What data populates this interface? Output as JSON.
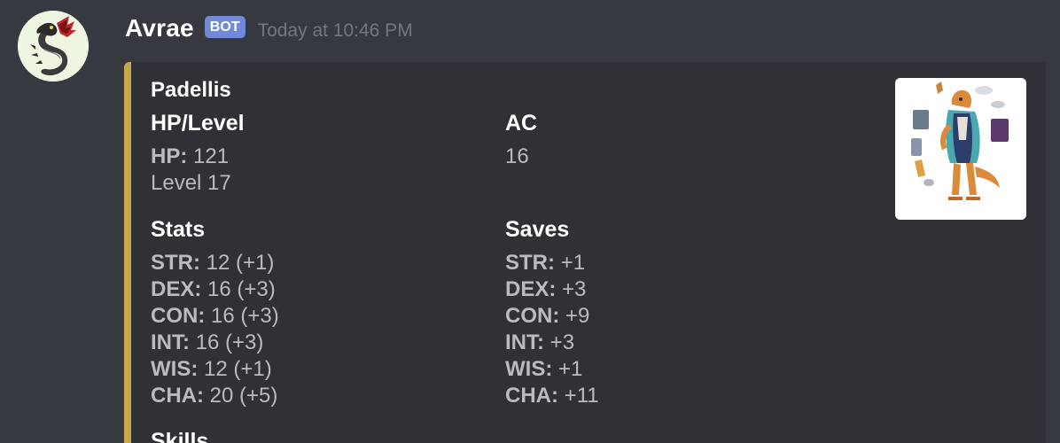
{
  "message": {
    "author": "Avrae",
    "bot_tag": "BOT",
    "timestamp": "Today at 10:46 PM",
    "avatar_icon": "dragon-avatar-icon"
  },
  "embed": {
    "accent_color": "#c9a84c",
    "title": "Padellis",
    "thumbnail_icon": "character-portrait-icon",
    "hp_level": {
      "name": "HP/Level",
      "hp_label": "HP:",
      "hp_value": "121",
      "level": "Level 17"
    },
    "ac": {
      "name": "AC",
      "value": "16"
    },
    "stats": {
      "name": "Stats",
      "rows": [
        {
          "label": "STR:",
          "value": "12 (+1)"
        },
        {
          "label": "DEX:",
          "value": "16 (+3)"
        },
        {
          "label": "CON:",
          "value": "16 (+3)"
        },
        {
          "label": "INT:",
          "value": "16 (+3)"
        },
        {
          "label": "WIS:",
          "value": "12 (+1)"
        },
        {
          "label": "CHA:",
          "value": "20 (+5)"
        }
      ]
    },
    "saves": {
      "name": "Saves",
      "rows": [
        {
          "label": "STR:",
          "value": "+1"
        },
        {
          "label": "DEX:",
          "value": "+3"
        },
        {
          "label": "CON:",
          "value": "+9"
        },
        {
          "label": "INT:",
          "value": "+3"
        },
        {
          "label": "WIS:",
          "value": "+1"
        },
        {
          "label": "CHA:",
          "value": "+11"
        }
      ]
    },
    "skills": {
      "name": "Skills"
    }
  }
}
